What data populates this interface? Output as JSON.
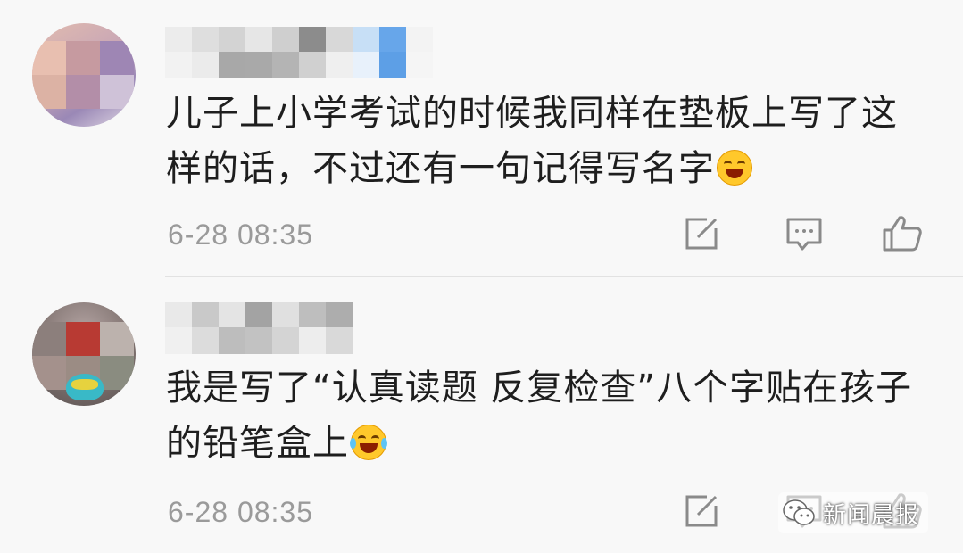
{
  "comments": [
    {
      "content": "儿子上小学考试的时候我同样在垫板上写了这样的话，不过还有一句记得写名字",
      "emoji": "laughing-emoji",
      "timestamp": "6-28 08:35"
    },
    {
      "content": "我是写了“认真读题  反复检查”八个字贴在孩子的铅笔盒上",
      "emoji": "crying-laughing-emoji",
      "timestamp": "6-28 08:35"
    }
  ],
  "icons": {
    "edit": "edit-icon",
    "reply": "reply-icon",
    "like": "like-icon"
  },
  "watermark": {
    "text": "新闻晨报"
  },
  "colors": {
    "background": "#f8f8f8",
    "text": "#1e1e1e",
    "timestamp": "#9a9a9a",
    "icon": "#8a8a8a"
  }
}
